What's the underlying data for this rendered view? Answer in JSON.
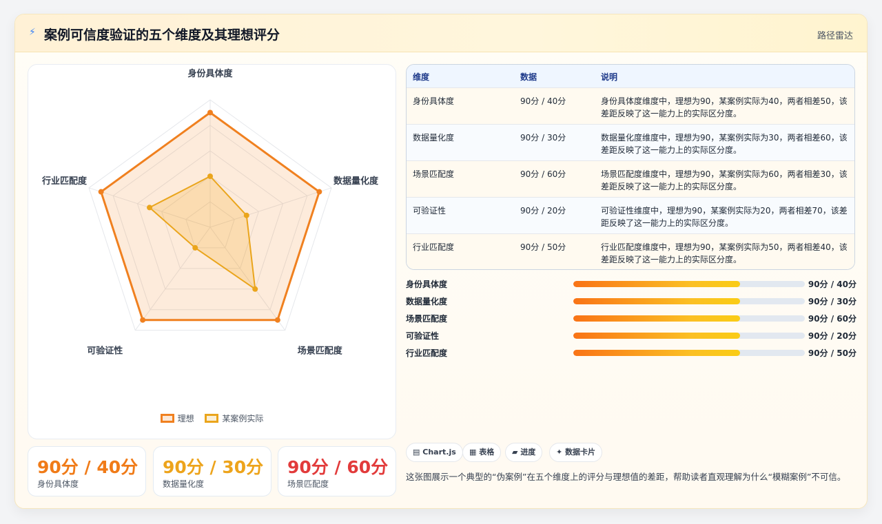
{
  "header": {
    "title": "案例可信度验证的五个维度及其理想评分",
    "tag": "路径雷达"
  },
  "colors": {
    "ideal": "#f0801f",
    "actual": "#eaa51c",
    "stat_1": "#f07b18",
    "stat_2": "#eda41c",
    "stat_3": "#e23b3b"
  },
  "chart_data": {
    "type": "radar",
    "axes": [
      "身份具体度",
      "数据量化度",
      "场景匹配度",
      "可验证性",
      "行业匹配度"
    ],
    "range": [
      0,
      100
    ],
    "grid": true,
    "legend": "bottom",
    "series": [
      {
        "name": "理想",
        "values": [
          90,
          90,
          90,
          90,
          90
        ]
      },
      {
        "name": "某案例实际",
        "values": [
          40,
          30,
          60,
          20,
          50
        ]
      }
    ]
  },
  "stats": [
    {
      "value": "90分 / 40分",
      "label": "身份具体度"
    },
    {
      "value": "90分 / 30分",
      "label": "数据量化度"
    },
    {
      "value": "90分 / 60分",
      "label": "场景匹配度"
    }
  ],
  "table": {
    "headers": [
      "维度",
      "数据",
      "说明"
    ],
    "rows": [
      {
        "dim": "身份具体度",
        "data": "90分 / 40分",
        "note": "身份具体度维度中，理想为90，某案例实际为40，两者相差50，该差距反映了这一能力上的实际区分度。"
      },
      {
        "dim": "数据量化度",
        "data": "90分 / 30分",
        "note": "数据量化度维度中，理想为90，某案例实际为30，两者相差60，该差距反映了这一能力上的实际区分度。"
      },
      {
        "dim": "场景匹配度",
        "data": "90分 / 60分",
        "note": "场景匹配度维度中，理想为90，某案例实际为60，两者相差30，该差距反映了这一能力上的实际区分度。"
      },
      {
        "dim": "可验证性",
        "data": "90分 / 20分",
        "note": "可验证性维度中，理想为90，某案例实际为20，两者相差70，该差距反映了这一能力上的实际区分度。"
      },
      {
        "dim": "行业匹配度",
        "data": "90分 / 50分",
        "note": "行业匹配度维度中，理想为90，某案例实际为50，两者相差40，该差距反映了这一能力上的实际区分度。"
      }
    ]
  },
  "progress": [
    {
      "name": "身份具体度",
      "value": "90分 / 40分",
      "fill": 0.72
    },
    {
      "name": "数据量化度",
      "value": "90分 / 30分",
      "fill": 0.72
    },
    {
      "name": "场景匹配度",
      "value": "90分 / 60分",
      "fill": 0.72
    },
    {
      "name": "可验证性",
      "value": "90分 / 20分",
      "fill": 0.72
    },
    {
      "name": "行业匹配度",
      "value": "90分 / 50分",
      "fill": 0.72
    }
  ],
  "chips": [
    {
      "icon": "chart-icon",
      "glyph": "▤",
      "label": "Chart.js"
    },
    {
      "icon": "table-icon",
      "glyph": "▦",
      "label": "表格"
    },
    {
      "icon": "progress-icon",
      "glyph": "▰",
      "label": "进度"
    },
    {
      "icon": "sparkle-icon",
      "glyph": "✦",
      "label": "数据卡片"
    }
  ],
  "description": "这张图展示一个典型的“伪案例”在五个维度上的评分与理想值的差距，帮助读者直观理解为什么“模糊案例”不可信。"
}
